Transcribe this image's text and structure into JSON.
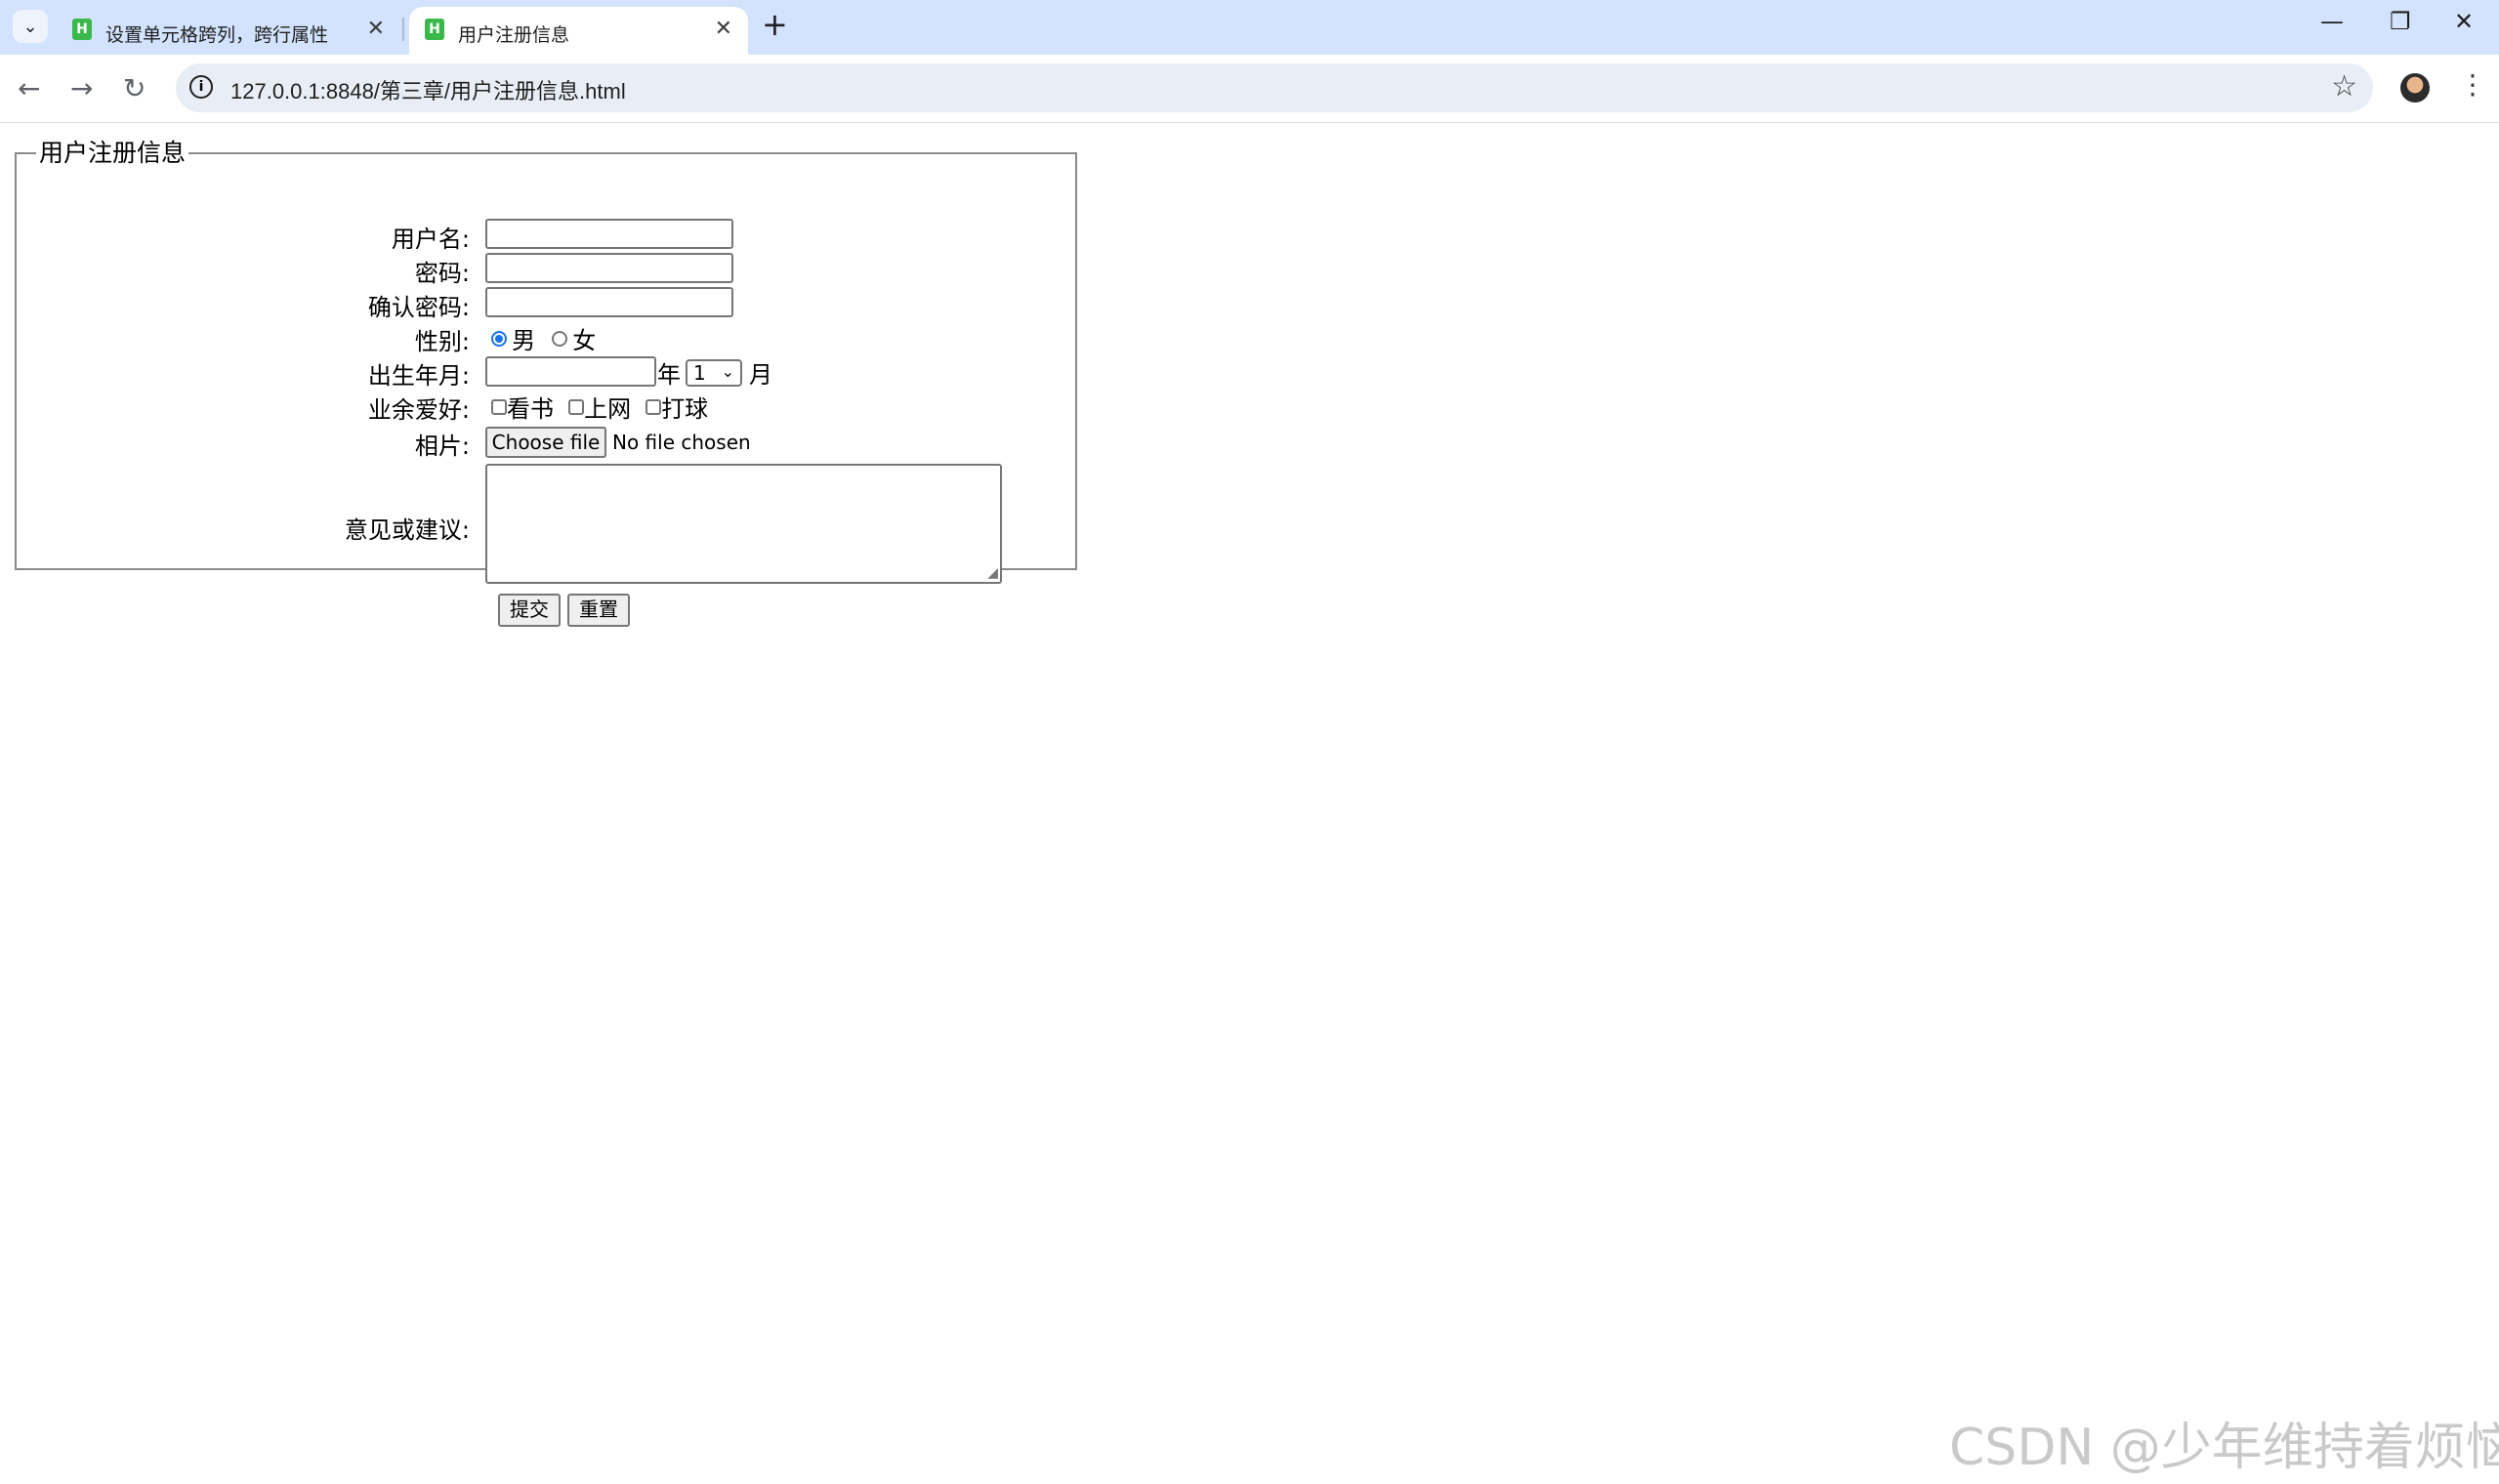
{
  "browser": {
    "tabs": [
      {
        "title": "设置单元格跨列，跨行属性",
        "active": false
      },
      {
        "title": "用户注册信息",
        "active": true
      }
    ],
    "url": "127.0.0.1:8848/第三章/用户注册信息.html"
  },
  "form": {
    "legend": "用户注册信息",
    "username_label": "用户名:",
    "password_label": "密码:",
    "confirm_label": "确认密码:",
    "gender_label": "性别:",
    "gender_options": [
      "男",
      "女"
    ],
    "gender_selected": "男",
    "birth_label": "出生年月:",
    "year_suffix": "年",
    "month_value": "1",
    "month_suffix": "月",
    "hobby_label": "业余爱好:",
    "hobbies": [
      "看书",
      "上网",
      "打球"
    ],
    "photo_label": "相片:",
    "file_button": "Choose file",
    "file_status": "No file chosen",
    "comment_label": "意见或建议:",
    "submit": "提交",
    "reset": "重置"
  },
  "watermark": "CSDN @少年维持着烦恼."
}
